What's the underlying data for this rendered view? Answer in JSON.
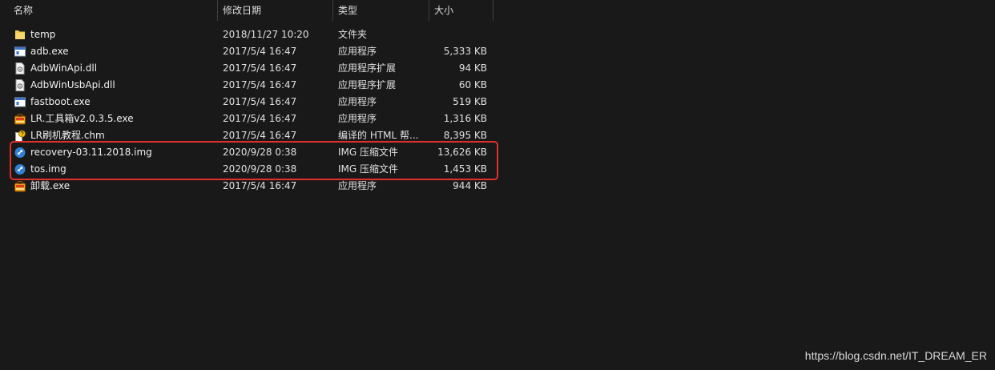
{
  "columns": {
    "name": "名称",
    "date": "修改日期",
    "type": "类型",
    "size": "大小",
    "sort_indicator": "^"
  },
  "files": [
    {
      "icon": "folder-icon",
      "name": "temp",
      "date": "2018/11/27 10:20",
      "type": "文件夹",
      "size": ""
    },
    {
      "icon": "exe-app-icon",
      "name": "adb.exe",
      "date": "2017/5/4 16:47",
      "type": "应用程序",
      "size": "5,333 KB"
    },
    {
      "icon": "dll-gear-icon",
      "name": "AdbWinApi.dll",
      "date": "2017/5/4 16:47",
      "type": "应用程序扩展",
      "size": "94 KB"
    },
    {
      "icon": "dll-gear-icon",
      "name": "AdbWinUsbApi.dll",
      "date": "2017/5/4 16:47",
      "type": "应用程序扩展",
      "size": "60 KB"
    },
    {
      "icon": "exe-app-icon",
      "name": "fastboot.exe",
      "date": "2017/5/4 16:47",
      "type": "应用程序",
      "size": "519 KB"
    },
    {
      "icon": "toolbox-app-icon",
      "name": "LR.工具箱v2.0.3.5.exe",
      "date": "2017/5/4 16:47",
      "type": "应用程序",
      "size": "1,316 KB"
    },
    {
      "icon": "chm-help-icon",
      "name": "LR刷机教程.chm",
      "date": "2017/5/4 16:47",
      "type": "编译的 HTML 帮...",
      "size": "8,395 KB"
    },
    {
      "icon": "img-archive-icon",
      "name": "recovery-03.11.2018.img",
      "date": "2020/9/28 0:38",
      "type": "IMG 压缩文件",
      "size": "13,626 KB"
    },
    {
      "icon": "img-archive-icon",
      "name": "tos.img",
      "date": "2020/9/28 0:38",
      "type": "IMG 压缩文件",
      "size": "1,453 KB"
    },
    {
      "icon": "toolbox-app-icon",
      "name": "卸载.exe",
      "date": "2017/5/4 16:47",
      "type": "应用程序",
      "size": "944 KB"
    }
  ],
  "watermark": "https://blog.csdn.net/IT_DREAM_ER",
  "colors": {
    "background": "#191919",
    "highlight_border": "#e0302a",
    "folder": "#f2c94c"
  }
}
